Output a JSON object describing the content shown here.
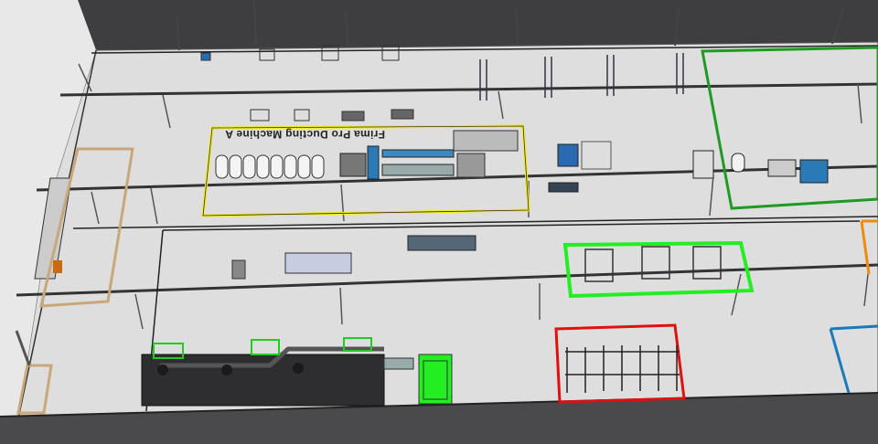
{
  "layout": {
    "machine_label": "Frima Pro Ducting Machine A"
  },
  "colors": {
    "floor": "#dcdcdc",
    "wall": "#3c3c3e",
    "zone_yellow": "#f0ea1a",
    "zone_green": "#1f9a22",
    "zone_lime": "#22ee22",
    "zone_red": "#e01010",
    "zone_orange": "#f08a10",
    "zone_blue": "#1a7ab8"
  }
}
